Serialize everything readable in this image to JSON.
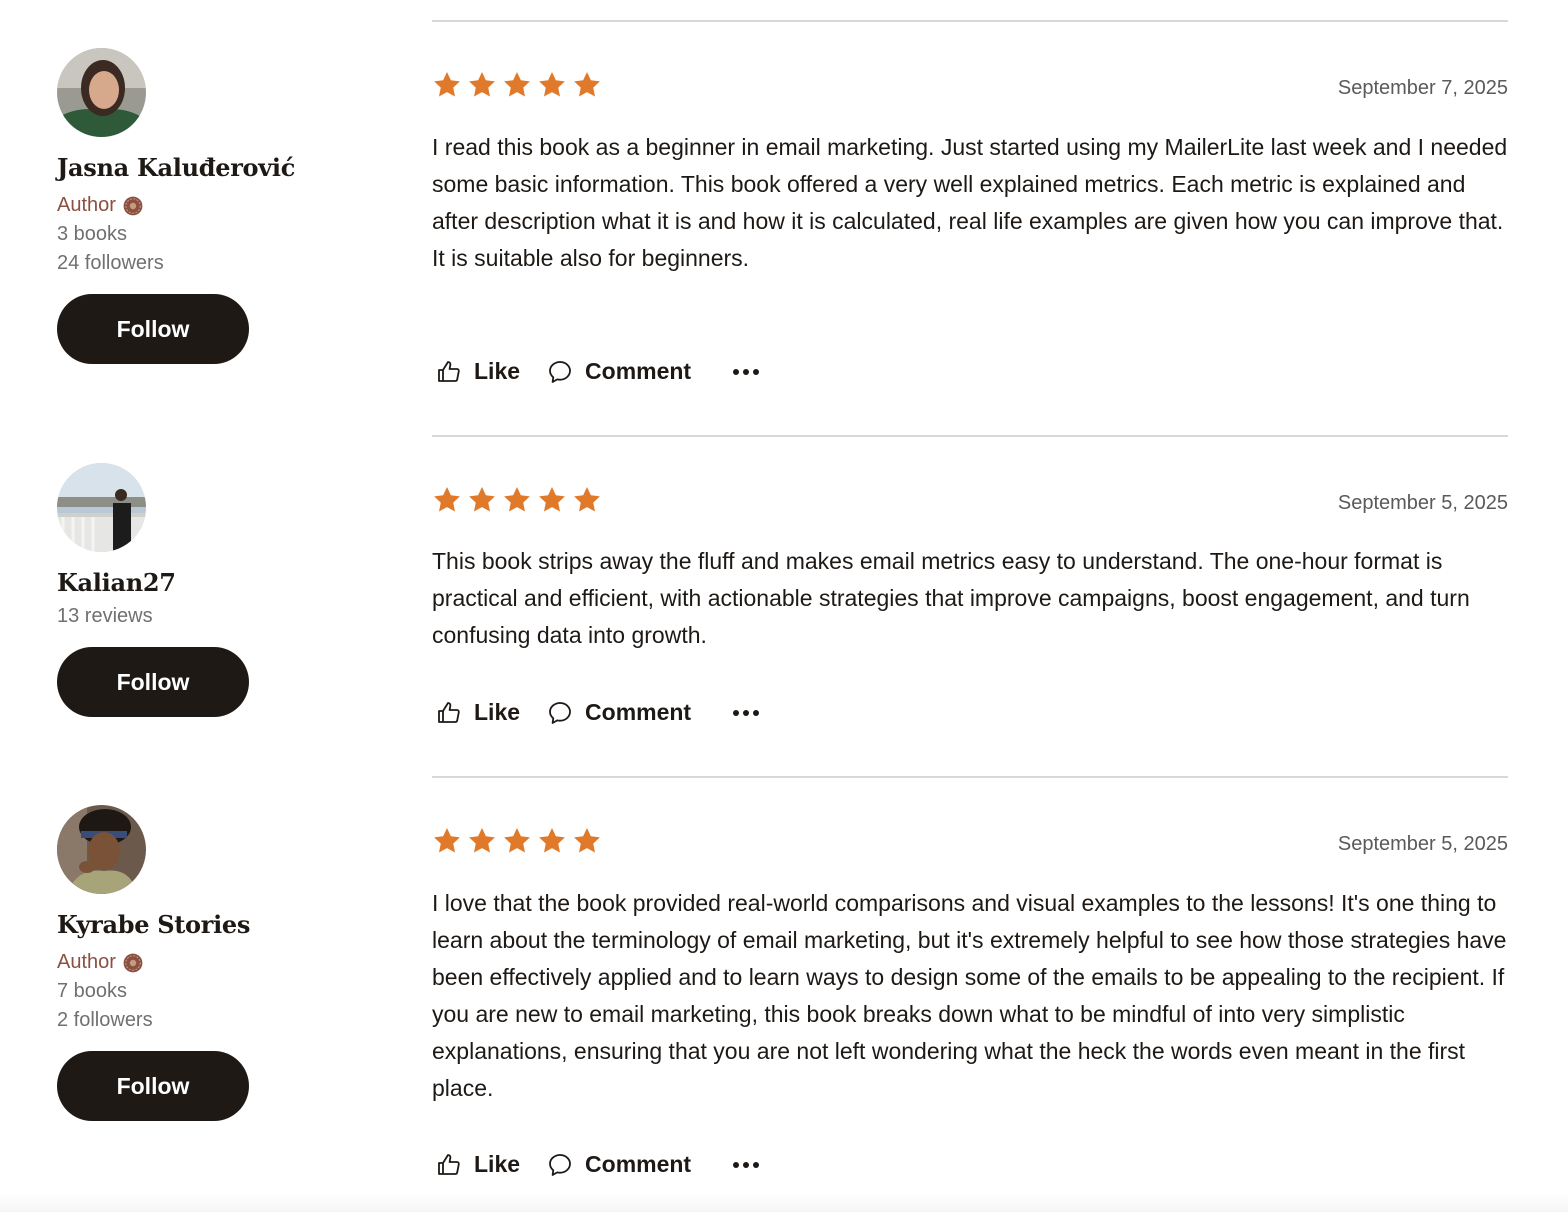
{
  "reviews": [
    {
      "reviewer": {
        "name": "Jasna Kaluđerović",
        "role": "Author",
        "stats": [
          "3 books",
          "24 followers"
        ],
        "follow_label": "Follow"
      },
      "rating": 5,
      "date": "September 7, 2025",
      "text": "I read this book as a beginner in email marketing. Just started using my MailerLite last week and I needed some basic information. This book offered a very well explained metrics. Each metric is explained and after description what it is and how it is calculated, real life examples are given how you can improve that. It is suitable also for beginners.",
      "actions": {
        "like": "Like",
        "comment": "Comment"
      }
    },
    {
      "reviewer": {
        "name": "Kalian27",
        "role": "",
        "stats": [
          "13 reviews"
        ],
        "follow_label": "Follow"
      },
      "rating": 5,
      "date": "September 5, 2025",
      "text": "This book strips away the fluff and makes email metrics easy to understand. The one-hour format is practical and efficient, with actionable strategies that improve campaigns, boost engagement, and turn confusing data into growth.",
      "actions": {
        "like": "Like",
        "comment": "Comment"
      }
    },
    {
      "reviewer": {
        "name": "Kyrabe Stories",
        "role": "Author",
        "stats": [
          "7 books",
          "2 followers"
        ],
        "follow_label": "Follow"
      },
      "rating": 5,
      "date": "September 5, 2025",
      "text": "I love that the book provided real-world comparisons and visual examples to the lessons! It's one thing to learn about the terminology of email marketing, but it's extremely helpful to see how those strategies have been effectively applied and to learn ways to design some of the emails to be appealing to the recipient. If you are new to email marketing, this book breaks down what to be mindful of into very simplistic explanations, ensuring that you are not left wondering what the heck the words even meant in the first place.",
      "actions": {
        "like": "Like",
        "comment": "Comment"
      }
    }
  ],
  "colors": {
    "star": "#e07a2a",
    "follow_bg": "#1e1915",
    "author_label": "#8a5141",
    "meta_text": "#707070",
    "divider": "#d8d8d8"
  },
  "icons": {
    "like": "thumbs-up-icon",
    "comment": "speech-bubble-icon",
    "more": "ellipsis-icon",
    "author_badge": "author-badge-icon",
    "star": "star-icon"
  }
}
